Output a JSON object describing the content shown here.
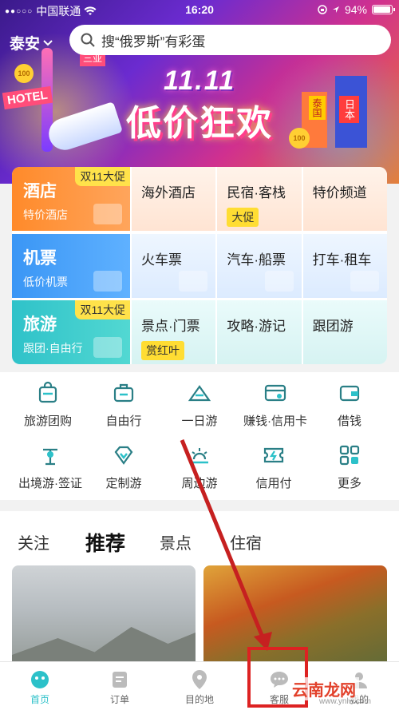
{
  "status_bar": {
    "carrier": "中国联通",
    "time": "16:20",
    "battery": "94%"
  },
  "header": {
    "city": "泰安",
    "search_placeholder": "搜“俄罗斯”有彩蛋"
  },
  "banner": {
    "date": "11.11",
    "title": "低价狂欢",
    "hotel_sign": "HOTEL",
    "coin_left": "100",
    "coin_right": "100",
    "sign_sanya": "三亚",
    "sign_thailand": "泰国",
    "sign_japan": "日本"
  },
  "grid": {
    "row1": {
      "main": {
        "title": "酒店",
        "subtitle": "特价酒店",
        "badge": "双11大促"
      },
      "subs": [
        {
          "label": "海外酒店"
        },
        {
          "label": "民宿·客栈",
          "tag": "大促"
        },
        {
          "label": "特价频道"
        }
      ]
    },
    "row2": {
      "main": {
        "title": "机票",
        "subtitle": "低价机票"
      },
      "subs": [
        {
          "label": "火车票"
        },
        {
          "label": "汽车·船票"
        },
        {
          "label": "打车·租车"
        }
      ]
    },
    "row3": {
      "main": {
        "title": "旅游",
        "subtitle": "跟团·自由行",
        "badge": "双11大促"
      },
      "subs": [
        {
          "label": "景点·门票",
          "tag": "赏红叶"
        },
        {
          "label": "攻略·游记"
        },
        {
          "label": "跟团游"
        }
      ]
    }
  },
  "quick_icons": [
    {
      "label": "旅游团购",
      "icon": "bag-icon"
    },
    {
      "label": "自由行",
      "icon": "suitcase-icon"
    },
    {
      "label": "一日游",
      "icon": "mountain-icon"
    },
    {
      "label": "赚钱·信用卡",
      "icon": "card-icon"
    },
    {
      "label": "借钱",
      "icon": "wallet-icon"
    },
    {
      "label": "出境游·签证",
      "icon": "globe-icon"
    },
    {
      "label": "定制游",
      "icon": "diamond-icon"
    },
    {
      "label": "周边游",
      "icon": "sunrise-icon"
    },
    {
      "label": "信用付",
      "icon": "ticket-icon"
    },
    {
      "label": "更多",
      "icon": "grid-icon"
    }
  ],
  "tabs": [
    "关注",
    "推荐",
    "景点",
    "住宿"
  ],
  "bottom_nav": [
    {
      "label": "首页",
      "icon": "home-icon",
      "active": true
    },
    {
      "label": "订单",
      "icon": "order-icon"
    },
    {
      "label": "目的地",
      "icon": "location-icon"
    },
    {
      "label": "客服",
      "icon": "chat-icon"
    },
    {
      "label": "我的",
      "icon": "profile-icon"
    }
  ],
  "watermark": {
    "text": "云南龙网",
    "url": "www.ynlw.com"
  },
  "colors": {
    "accent": "#2cc1c9",
    "hotel": "#ff8a2a",
    "flight": "#3a96f5",
    "travel": "#2fc2c9",
    "badge": "#ffe24a",
    "annotation": "#d22"
  }
}
